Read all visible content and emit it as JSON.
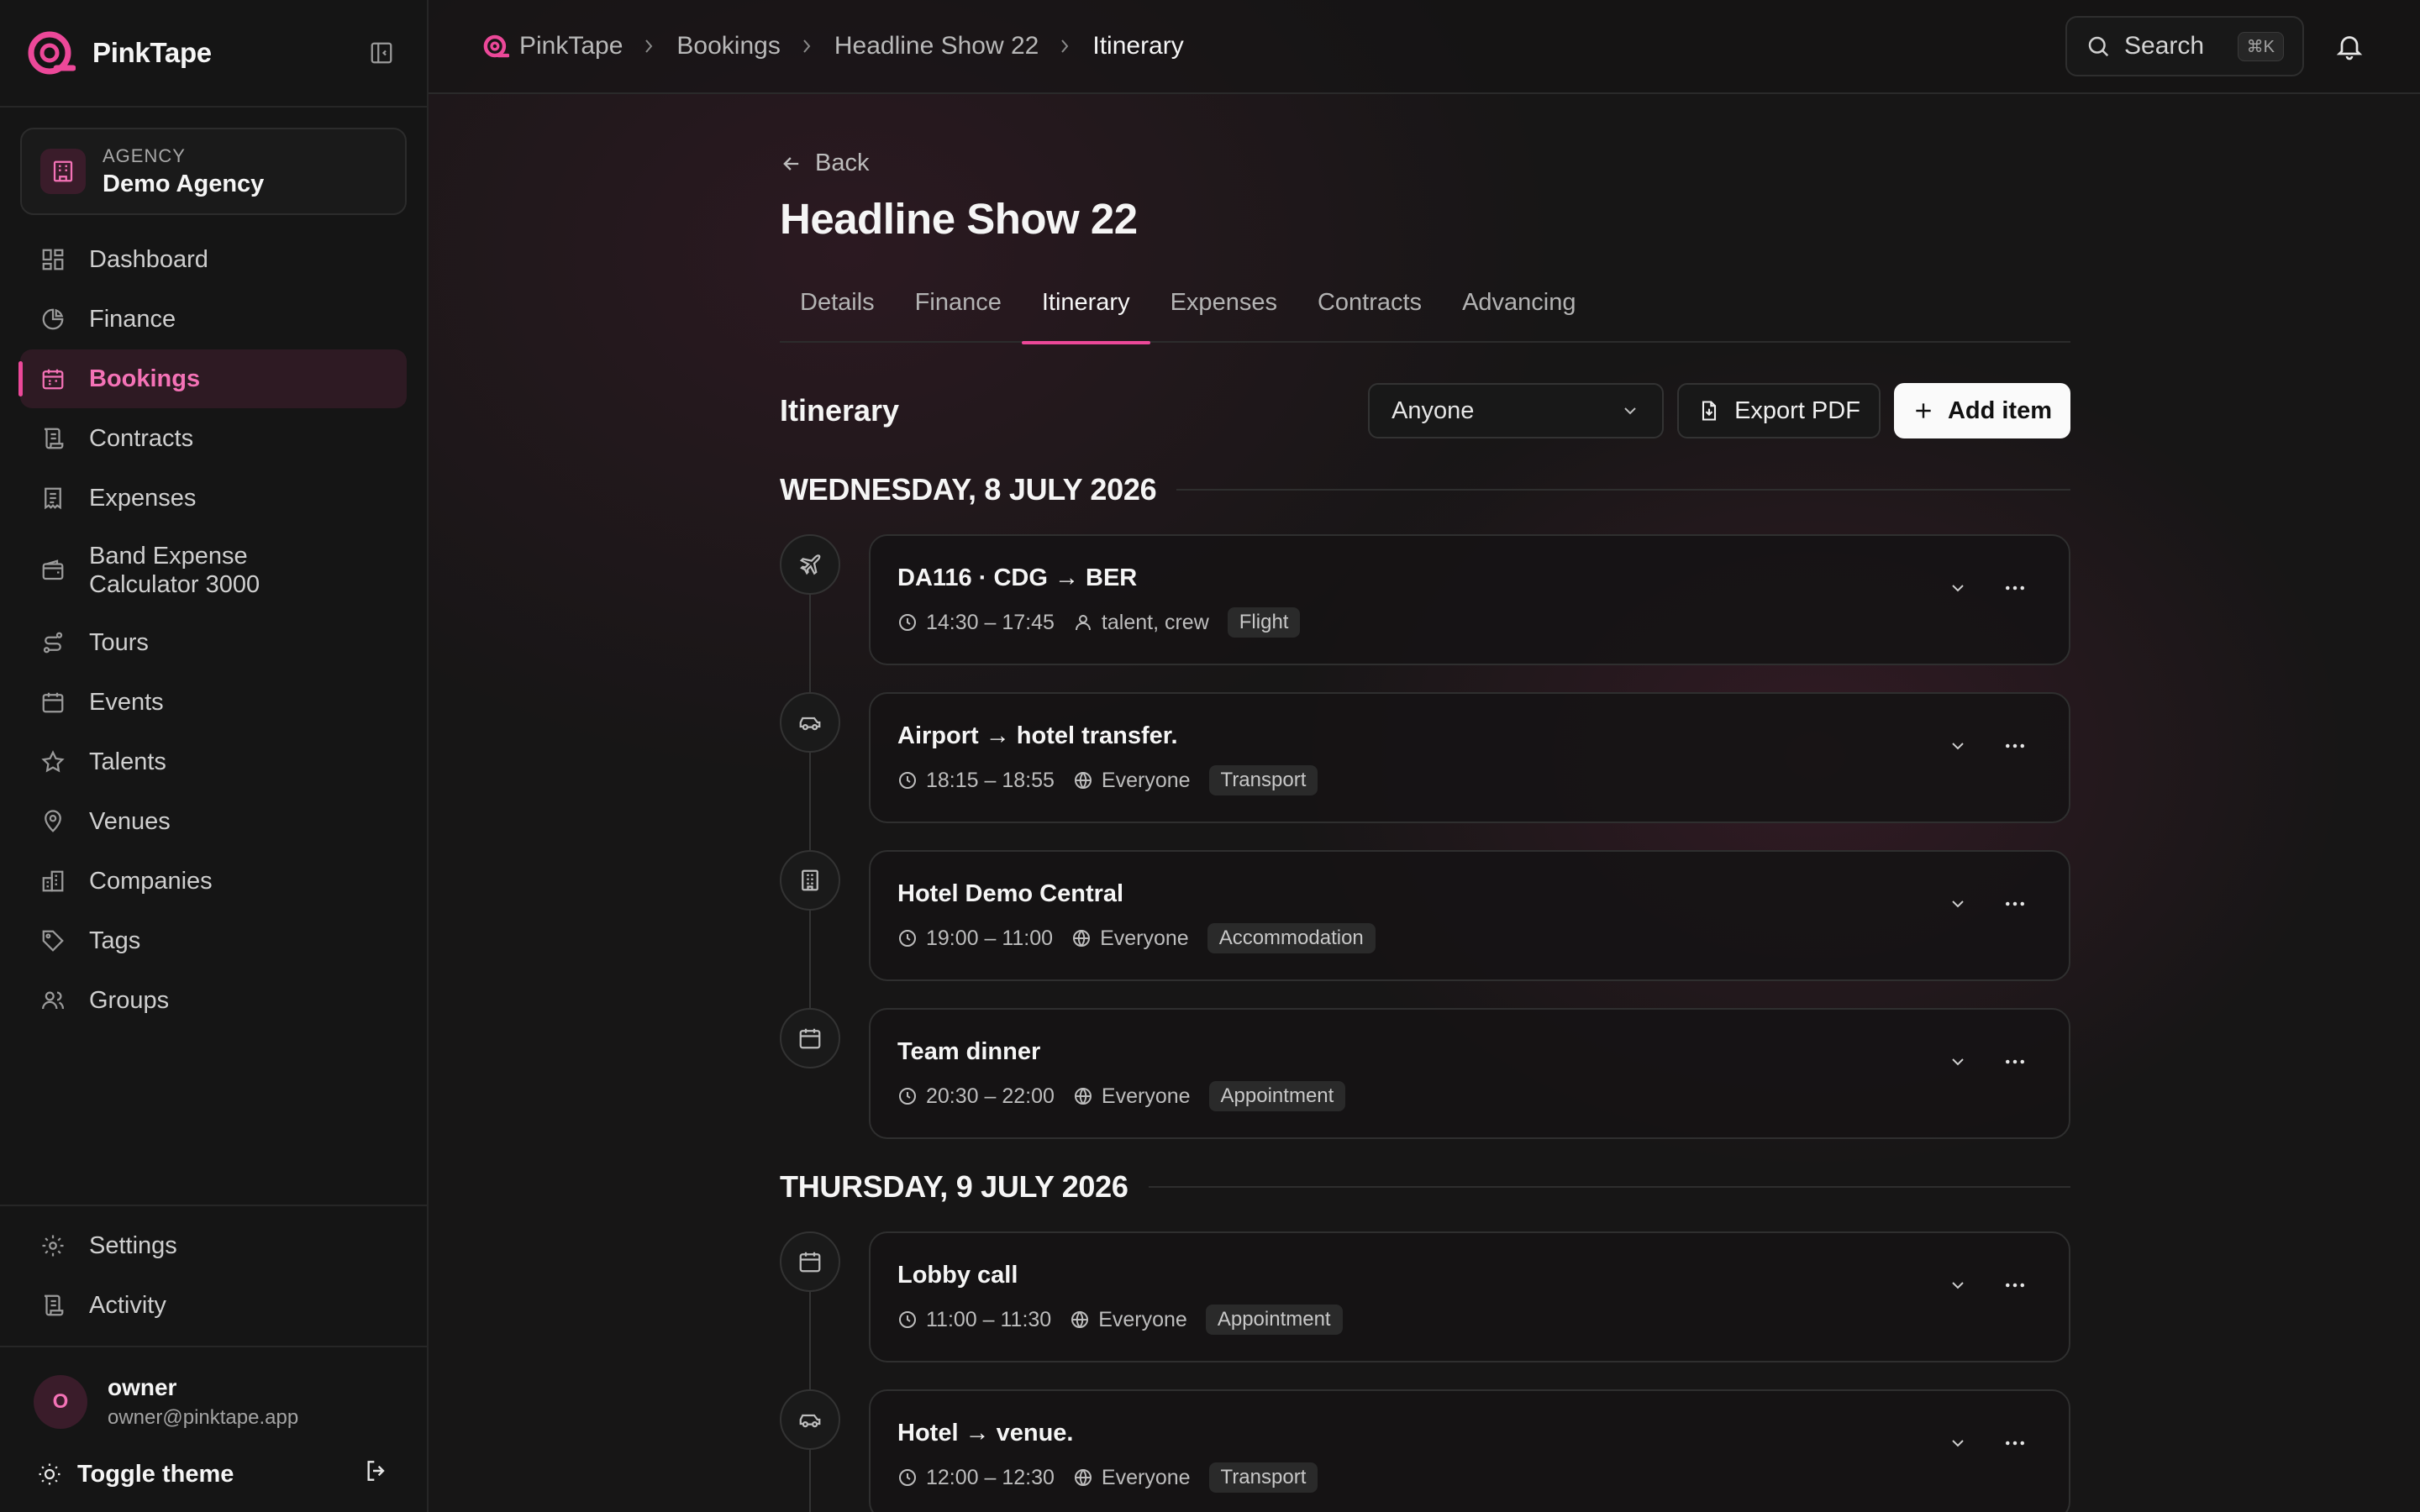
{
  "app": {
    "name": "PinkTape",
    "accent": "#ec4899"
  },
  "agency": {
    "label": "AGENCY",
    "name": "Demo Agency"
  },
  "nav": [
    {
      "label": "Dashboard",
      "icon": "dashboard-icon"
    },
    {
      "label": "Finance",
      "icon": "pie-chart-icon"
    },
    {
      "label": "Bookings",
      "icon": "calendar-icon",
      "active": true
    },
    {
      "label": "Contracts",
      "icon": "scroll-icon"
    },
    {
      "label": "Expenses",
      "icon": "receipt-icon"
    },
    {
      "label": "Band Expense Calculator 3000",
      "icon": "wallet-icon"
    },
    {
      "label": "Tours",
      "icon": "route-icon"
    },
    {
      "label": "Events",
      "icon": "calendar-icon"
    },
    {
      "label": "Talents",
      "icon": "star-icon"
    },
    {
      "label": "Venues",
      "icon": "map-pin-icon"
    },
    {
      "label": "Companies",
      "icon": "building-icon"
    },
    {
      "label": "Tags",
      "icon": "tag-icon"
    },
    {
      "label": "Groups",
      "icon": "users-icon"
    }
  ],
  "nav_bottom": [
    {
      "label": "Settings",
      "icon": "gear-icon"
    },
    {
      "label": "Activity",
      "icon": "scroll-icon"
    }
  ],
  "user": {
    "initial": "O",
    "name": "owner",
    "email": "owner@pinktape.app"
  },
  "toggle_theme": "Toggle theme",
  "breadcrumb": [
    "PinkTape",
    "Bookings",
    "Headline Show 22",
    "Itinerary"
  ],
  "search": {
    "label": "Search",
    "shortcut": "⌘K"
  },
  "page": {
    "back": "Back",
    "title": "Headline Show 22",
    "tabs": [
      "Details",
      "Finance",
      "Itinerary",
      "Expenses",
      "Contracts",
      "Advancing"
    ],
    "active_tab": "Itinerary"
  },
  "itinerary": {
    "heading": "Itinerary",
    "filter": "Anyone",
    "export_label": "Export PDF",
    "add_label": "Add item",
    "days": [
      {
        "label": "WEDNESDAY, 8 JULY 2026",
        "items": [
          {
            "title": "DA116 · CDG → BER",
            "time": "14:30 – 17:45",
            "audience": "talent, crew",
            "audience_icon": "user-icon",
            "tag": "Flight",
            "icon": "plane-icon"
          },
          {
            "title": "Airport → hotel transfer.",
            "time": "18:15 – 18:55",
            "audience": "Everyone",
            "audience_icon": "globe-icon",
            "tag": "Transport",
            "icon": "car-icon"
          },
          {
            "title": "Hotel Demo Central",
            "time": "19:00 – 11:00",
            "audience": "Everyone",
            "audience_icon": "globe-icon",
            "tag": "Accommodation",
            "icon": "hotel-icon"
          },
          {
            "title": "Team dinner",
            "time": "20:30 – 22:00",
            "audience": "Everyone",
            "audience_icon": "globe-icon",
            "tag": "Appointment",
            "icon": "calendar-icon"
          }
        ]
      },
      {
        "label": "THURSDAY, 9 JULY 2026",
        "items": [
          {
            "title": "Lobby call",
            "time": "11:00 – 11:30",
            "audience": "Everyone",
            "audience_icon": "globe-icon",
            "tag": "Appointment",
            "icon": "calendar-icon"
          },
          {
            "title": "Hotel → venue.",
            "time": "12:00 – 12:30",
            "audience": "Everyone",
            "audience_icon": "globe-icon",
            "tag": "Transport",
            "icon": "car-icon"
          }
        ]
      }
    ]
  }
}
